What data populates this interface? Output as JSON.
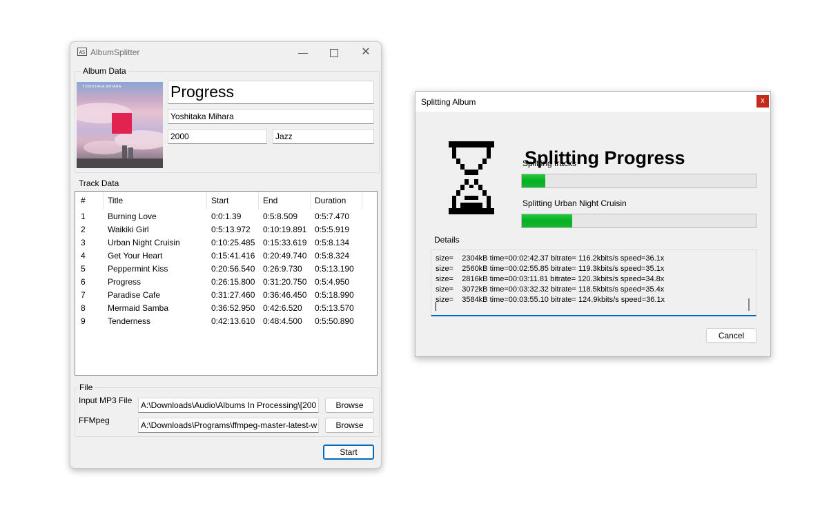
{
  "main_window": {
    "title": "AlbumSplitter",
    "album_group_label": "Album Data",
    "album": {
      "title": "Progress",
      "artist": "Yoshitaka Mihara",
      "year": "2000",
      "genre": "Jazz"
    },
    "art_text": "YOSHITAKA MIHARA",
    "track_group_label": "Track Data",
    "columns": [
      "#",
      "Title",
      "Start",
      "End",
      "Duration"
    ],
    "tracks": [
      {
        "num": "1",
        "title": "Burning Love",
        "start": "0:0:1.39",
        "end": "0:5:8.509",
        "duration": "0:5:7.470"
      },
      {
        "num": "2",
        "title": "Waikiki Girl",
        "start": "0:5:13.972",
        "end": "0:10:19.891",
        "duration": "0:5:5.919"
      },
      {
        "num": "3",
        "title": "Urban Night Cruisin",
        "start": "0:10:25.485",
        "end": "0:15:33.619",
        "duration": "0:5:8.134"
      },
      {
        "num": "4",
        "title": "Get Your Heart",
        "start": "0:15:41.416",
        "end": "0:20:49.740",
        "duration": "0:5:8.324"
      },
      {
        "num": "5",
        "title": "Peppermint Kiss",
        "start": "0:20:56.540",
        "end": "0:26:9.730",
        "duration": "0:5:13.190"
      },
      {
        "num": "6",
        "title": "Progress",
        "start": "0:26:15.800",
        "end": "0:31:20.750",
        "duration": "0:5:4.950"
      },
      {
        "num": "7",
        "title": "Paradise Cafe",
        "start": "0:31:27.460",
        "end": "0:36:46.450",
        "duration": "0:5:18.990"
      },
      {
        "num": "8",
        "title": "Mermaid Samba",
        "start": "0:36:52.950",
        "end": "0:42:6.520",
        "duration": "0:5:13.570"
      },
      {
        "num": "9",
        "title": "Tenderness",
        "start": "0:42:13.610",
        "end": "0:48:4.500",
        "duration": "0:5:50.890"
      }
    ],
    "file_group_label": "File",
    "input_mp3_label": "Input MP3 File",
    "input_mp3_value": "A:\\Downloads\\Audio\\Albums In Processing\\[200",
    "ffmpeg_label": "FFMpeg",
    "ffmpeg_value": "A:\\Downloads\\Programs\\ffmpeg-master-latest-w",
    "browse_label": "Browse",
    "start_label": "Start"
  },
  "dialog": {
    "title": "Splitting Album",
    "close_glyph": "x",
    "heading": "Splitting Progress",
    "tracks_label": "Splitting tracks",
    "tracks_progress": 0.1,
    "current_label": "Splitting Urban Night Cruisin",
    "current_progress": 0.215,
    "details_label": "Details",
    "log_lines": [
      "size=    2304kB time=00:02:42.37 bitrate= 116.2kbits/s speed=36.1x",
      "size=    2560kB time=00:02:55.85 bitrate= 119.3kbits/s speed=35.1x",
      "size=    2816kB time=00:03:11.81 bitrate= 120.3kbits/s speed=34.8x",
      "size=    3072kB time=00:03:32.32 bitrate= 118.5kbits/s speed=35.4x",
      "size=    3584kB time=00:03:55.10 bitrate= 124.9kbits/s speed=36.1x"
    ],
    "cancel_label": "Cancel",
    "progress_color": "#06b025",
    "accent_color": "#0067c0"
  }
}
